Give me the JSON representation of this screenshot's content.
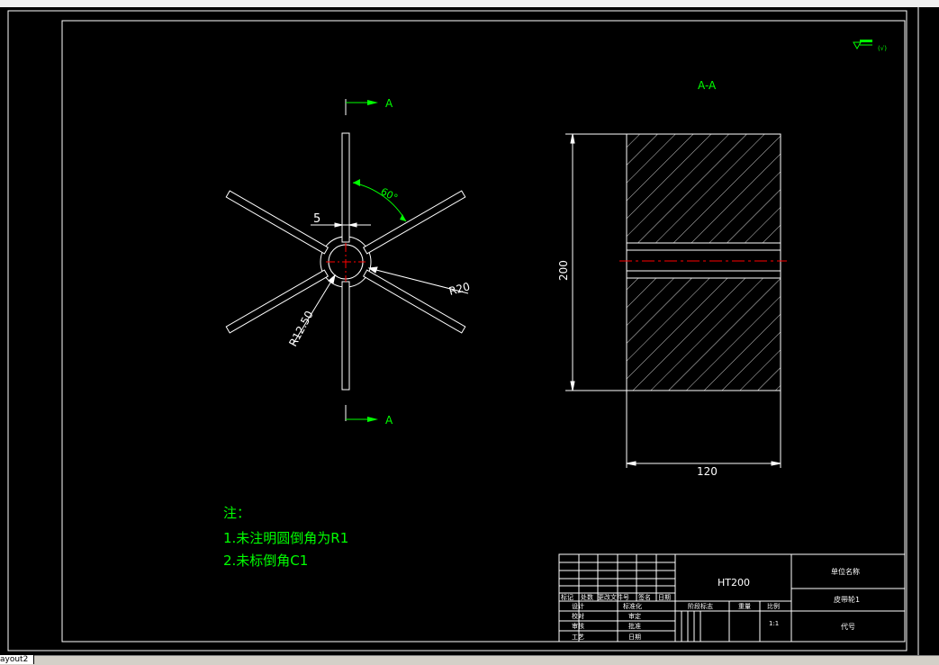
{
  "colors": {
    "background": "#000000",
    "line": "#ffffff",
    "annotation": "#00ff00",
    "centerline": "#ff0000"
  },
  "section_labels": {
    "top_arrow": "A",
    "bottom_arrow": "A",
    "view_title": "A-A"
  },
  "dimensions": {
    "slot_width": "5",
    "angle": "60°",
    "outer_radius": "R20",
    "inner_radius": "R12.50",
    "height": "200",
    "width": "120"
  },
  "notes": {
    "title": "注：",
    "line1": "1.未注明圆倒角为R1",
    "line2": "2.未标倒角C1"
  },
  "surface_symbol": "(√)",
  "title_block": {
    "material": "HT200",
    "unit_name": "单位名称",
    "part_name": "皮带轮1",
    "code_label": "代号",
    "change_headers": [
      "标记",
      "处数",
      "更改文件号",
      "签名",
      "日期"
    ],
    "roles_left": [
      "设计",
      "校对",
      "审核",
      "工艺"
    ],
    "roles_right": [
      "标准化",
      "审定",
      "批准",
      "日期"
    ],
    "stage_label": "阶段标志",
    "weight_label": "重量",
    "scale_label": "比例",
    "scale_value": "1:1"
  },
  "layout_tab": "ayout2"
}
